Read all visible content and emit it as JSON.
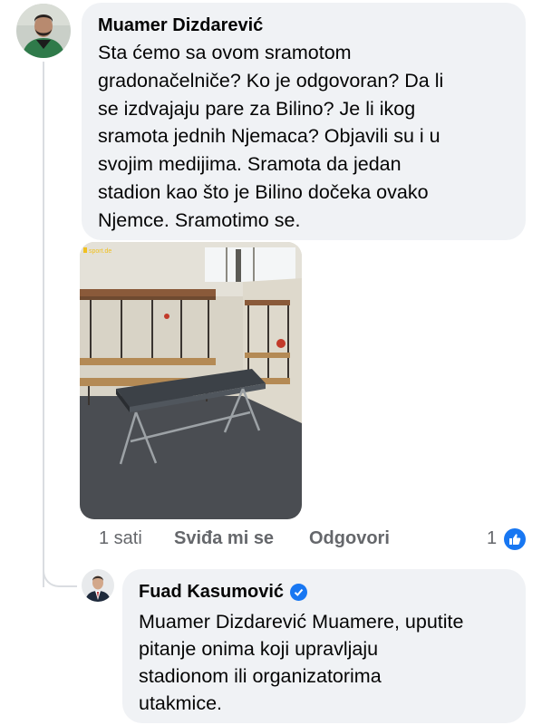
{
  "comment": {
    "author": "Muamer Dizdarević",
    "lines": [
      "Sta ćemo sa ovom sramotom",
      "gradonačelniče? Ko je odgovoran? Da li",
      "se izdvajaju pare za Bilino? Je li ikog",
      "sramota jednih Njemaca? Objavili su i u",
      "svojim medijima. Sramota da jedan",
      "stadion kao što je Bilino dočeka ovako",
      "Njemce. Sramotimo se."
    ],
    "photo_watermark": "sport.de",
    "time": "1 sati",
    "like_label": "Sviđa mi se",
    "reply_label": "Odgovori",
    "reaction_count": "1"
  },
  "reply": {
    "author": "Fuad Kasumović",
    "verified": true,
    "lines": [
      "Muamer Dizdarević Muamere, uputite",
      "pitanje onima koji upravljaju",
      "stadionom ili organizatorima",
      "utakmice."
    ]
  },
  "colors": {
    "bubble": "#f0f2f5",
    "meta_text": "#65676b",
    "accent": "#1877f2",
    "thread_line": "#dadde1"
  },
  "icons": {
    "like": "thumbs-up-icon",
    "verified": "verified-badge-icon"
  }
}
